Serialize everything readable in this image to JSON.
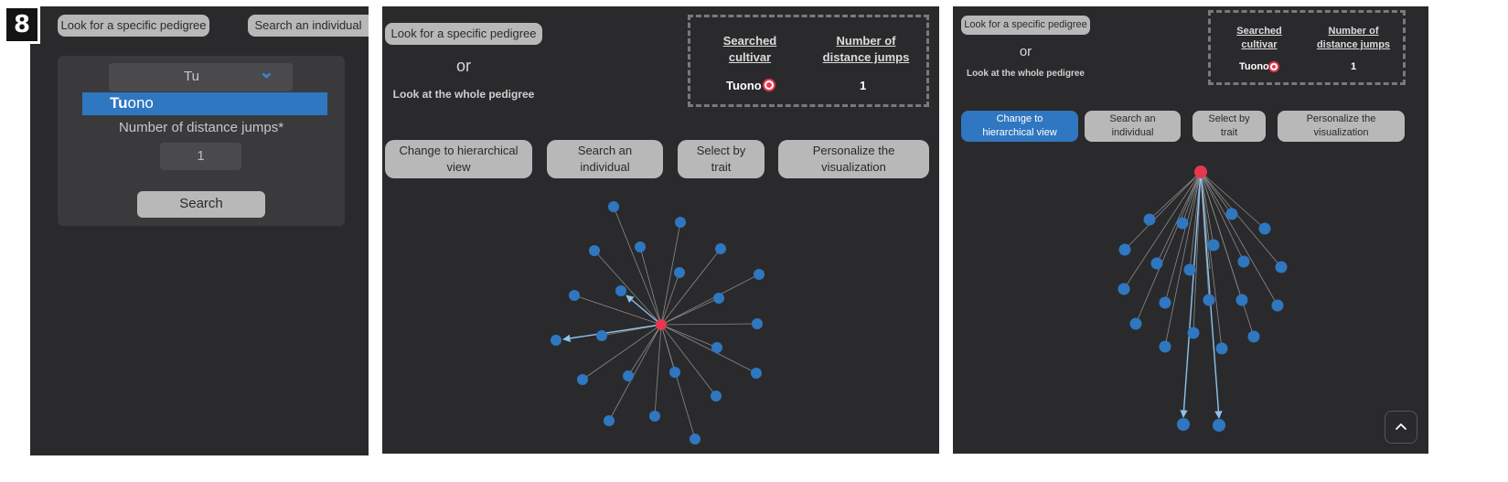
{
  "step_badge": "8",
  "panel1": {
    "look_button": "Look for a specific pedigree",
    "search_individual_button": "Search an individual",
    "select_value": "Tu",
    "chevron": "⌄",
    "option_match": "Tu",
    "option_rest": "ono",
    "distance_label": "Number of distance jumps*",
    "distance_value": "1",
    "search_button": "Search"
  },
  "panel2": {
    "look_button": "Look for a specific pedigree",
    "or_text": "or",
    "whole_text": "Look at the whole pedigree",
    "header_cultivar": "Searched cultivar",
    "header_jumps": "Number of distance jumps",
    "cultivar_value": "Tuono",
    "jumps_value": "1",
    "btn_hierarchical": "Change to hierarchical view",
    "btn_search": "Search an individual",
    "btn_trait": "Select by trait",
    "btn_personalize": "Personalize the visualization"
  },
  "panel3": {
    "look_button": "Look for a specific pedigree",
    "or_text": "or",
    "whole_text": "Look at the whole pedigree",
    "header_cultivar": "Searched cultivar",
    "header_jumps": "Number of distance jumps",
    "cultivar_value": "Tuono",
    "jumps_value": "1",
    "btn_hierarchical": "Change to hierarchical view",
    "btn_search": "Search an individual",
    "btn_trait": "Select by trait",
    "btn_personalize": "Personalize the visualization",
    "scroll_top_icon": "chevron-up-icon"
  },
  "colors": {
    "panel_bg": "#2a2a2c",
    "button_gray": "#b8b8b8",
    "accent_blue": "#2f77c0",
    "node_blue": "#2f77c0",
    "center_node_red": "#e8374f",
    "edge_gray": "#8a8a8a",
    "edge_highlight": "#8ec3f0"
  },
  "graph_radial": {
    "center": {
      "label": "Tuono"
    },
    "highlighted_count": 2
  },
  "graph_hier": {
    "root": {
      "label": "Tuono"
    },
    "highlighted_count": 2
  }
}
